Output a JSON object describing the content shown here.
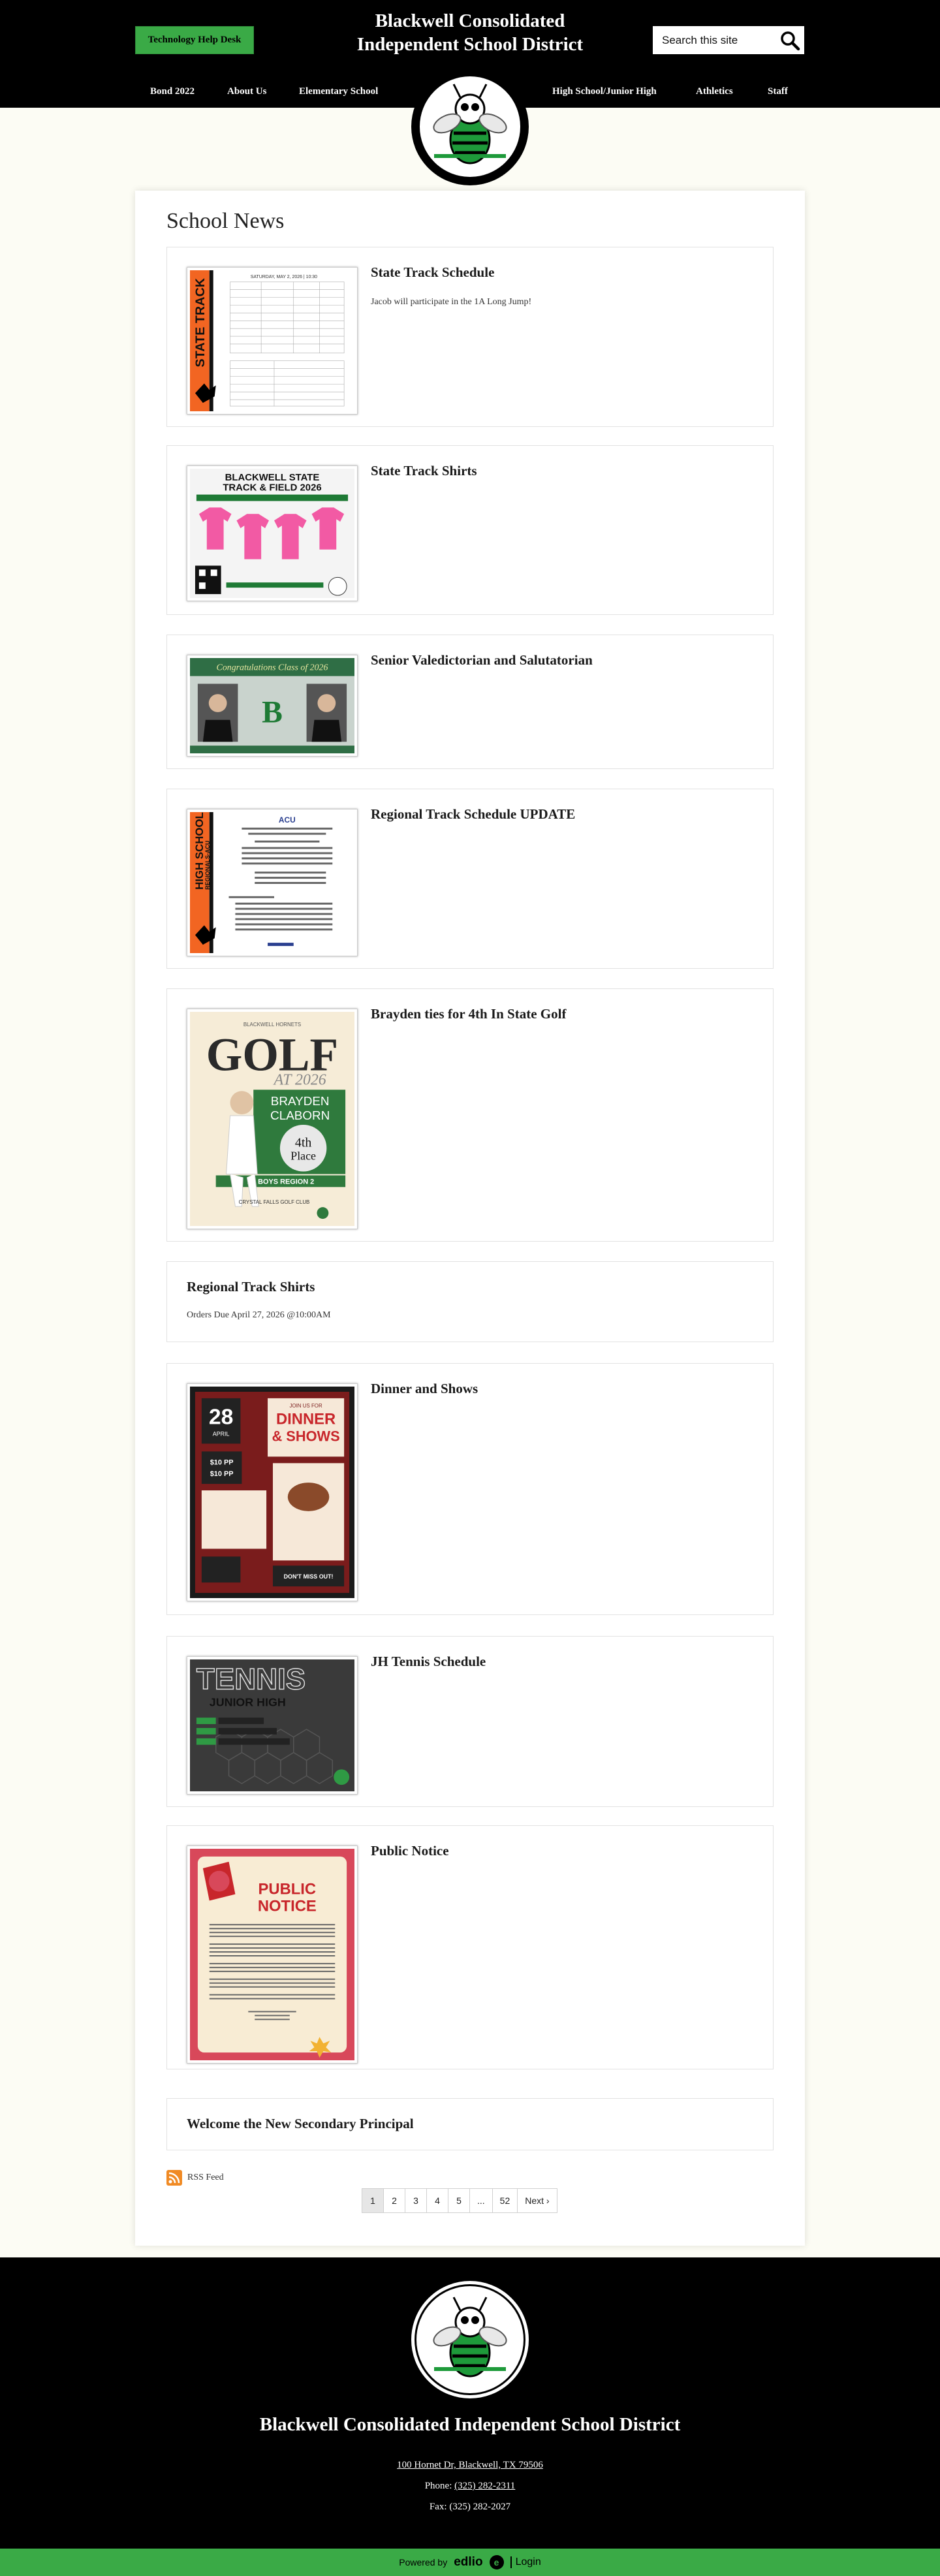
{
  "header": {
    "help_button": "Technology Help Desk",
    "title_line1": "Blackwell Consolidated",
    "title_line2": "Independent School District",
    "search_placeholder": "Search this site",
    "nav": [
      "Bond 2022",
      "About Us",
      "Elementary School",
      "High School/Junior High",
      "Athletics",
      "Staff"
    ]
  },
  "main": {
    "heading": "School News",
    "items": [
      {
        "title": "State Track Schedule",
        "desc": "Jacob will participate in the 1A Long Jump!"
      },
      {
        "title": "State Track Shirts",
        "desc": ""
      },
      {
        "title": "Senior Valedictorian and Salutatorian",
        "desc": ""
      },
      {
        "title": "Regional Track Schedule UPDATE",
        "desc": ""
      },
      {
        "title": "Brayden ties for 4th In State Golf",
        "desc": ""
      },
      {
        "title": "Regional Track Shirts",
        "desc": "Orders Due April 27, 2026 @10:00AM"
      },
      {
        "title": "Dinner and Shows",
        "desc": ""
      },
      {
        "title": "JH Tennis Schedule",
        "desc": ""
      },
      {
        "title": "Public Notice",
        "desc": ""
      },
      {
        "title": "Welcome the New Secondary Principal",
        "desc": ""
      }
    ],
    "thumb_text": {
      "track_side": "STATE TRACK",
      "track_header": "SATURDAY, MAY 2, 2026 | 10:30",
      "shirts_title1": "BLACKWELL STATE",
      "shirts_title2": "TRACK & FIELD 2026",
      "congrats": "Congratulations Class of 2026",
      "regional_side1": "HIGH SCHOOL",
      "regional_side2": "REGIONALS-ACU",
      "golf_small": "BLACKWELL HORNETS",
      "golf_big": "GOLF",
      "golf_year": "AT 2026",
      "golf_name1": "BRAYDEN",
      "golf_name2": "CLABORN",
      "golf_place1": "4th",
      "golf_place2": "Place",
      "golf_region": "1A BOYS REGION 2",
      "golf_course": "CRYSTAL FALLS GOLF CLUB",
      "dinner_date": "28",
      "dinner_month": "APRIL",
      "dinner_join": "JOIN US FOR",
      "dinner_title1": "DINNER",
      "dinner_title2": "& SHOWS",
      "dinner_price1": "$10 PP",
      "dinner_price2": "$10 PP",
      "dinner_bottom": "DON'T MISS OUT!",
      "tennis_title": "TENNIS",
      "tennis_sub": "JUNIOR HIGH",
      "notice_title1": "PUBLIC",
      "notice_title2": "NOTICE"
    },
    "rss": "RSS Feed",
    "pagination": [
      "1",
      "2",
      "3",
      "4",
      "5",
      "...",
      "52",
      "Next ›"
    ]
  },
  "footer": {
    "name": "Blackwell Consolidated Independent School District",
    "address": "100 Hornet Dr, Blackwell, TX 79506",
    "phone_label": "Phone: ",
    "phone": "(325) 282-2311",
    "fax": "Fax: (325) 282-2027",
    "powered_by": "Powered by",
    "edlio": "edlio",
    "login": "Login"
  },
  "colors": {
    "brand_green": "#3aaa46",
    "header_bg": "#000000",
    "page_bg": "#fcfcf4",
    "track_orange": "#f26522"
  }
}
